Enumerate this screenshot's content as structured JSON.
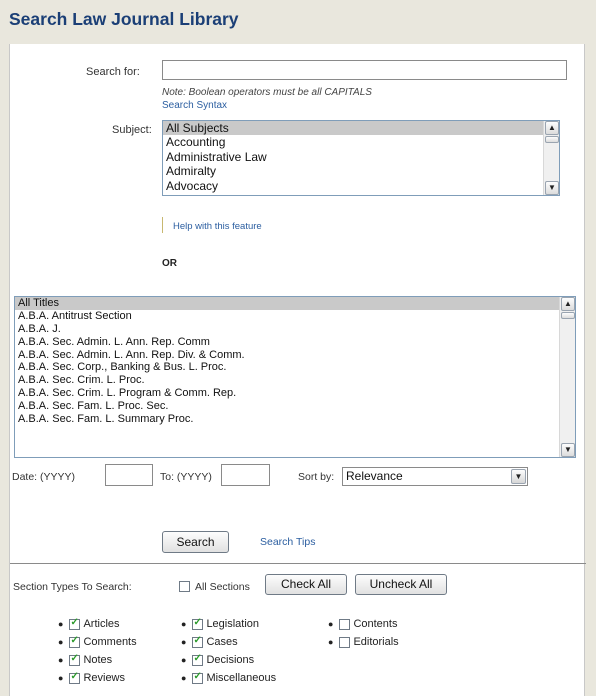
{
  "page": {
    "title": "Search Law Journal Library"
  },
  "search": {
    "label": "Search for:",
    "value": "",
    "note": "Note: Boolean operators must be all CAPITALS",
    "syntax_link": "Search Syntax"
  },
  "subject": {
    "label": "Subject:",
    "options": [
      "All Subjects",
      "Accounting",
      "Administrative Law",
      "Admiralty",
      "Advocacy"
    ],
    "selected": "All Subjects",
    "help_link": "Help with this feature"
  },
  "or_label": "OR",
  "titles": {
    "options": [
      "All Titles",
      "A.B.A. Antitrust Section",
      "A.B.A. J.",
      "A.B.A. Sec. Admin. L. Ann. Rep. Comm",
      "A.B.A. Sec. Admin. L. Ann. Rep. Div. & Comm.",
      "A.B.A. Sec. Corp., Banking & Bus. L. Proc.",
      "A.B.A. Sec. Crim. L. Proc.",
      "A.B.A. Sec. Crim. L. Program & Comm. Rep.",
      "A.B.A. Sec. Fam. L. Proc. Sec.",
      "A.B.A. Sec. Fam. L. Summary Proc."
    ],
    "selected": "All Titles"
  },
  "date": {
    "from_label": "Date: (YYYY)",
    "from_value": "",
    "to_label": "To: (YYYY)",
    "to_value": ""
  },
  "sort": {
    "label": "Sort by:",
    "value": "Relevance"
  },
  "actions": {
    "search_button": "Search",
    "tips_link": "Search Tips"
  },
  "sections": {
    "label": "Section Types To Search:",
    "all_sections_label": "All Sections",
    "all_sections_checked": false,
    "check_all_button": "Check All",
    "uncheck_all_button": "Uncheck All",
    "col1": [
      {
        "label": "Articles",
        "checked": true
      },
      {
        "label": "Comments",
        "checked": true
      },
      {
        "label": "Notes",
        "checked": true
      },
      {
        "label": "Reviews",
        "checked": true
      }
    ],
    "col2": [
      {
        "label": "Legislation",
        "checked": true
      },
      {
        "label": "Cases",
        "checked": true
      },
      {
        "label": "Decisions",
        "checked": true
      },
      {
        "label": "Miscellaneous",
        "checked": true
      }
    ],
    "col3": [
      {
        "label": "Contents",
        "checked": false
      },
      {
        "label": "Editorials",
        "checked": false
      }
    ]
  },
  "icons": {
    "scroll_up": "scroll-up-arrow-icon",
    "scroll_down": "scroll-down-arrow-icon",
    "dropdown": "chevron-down-icon",
    "checkmark": "checkmark-icon"
  },
  "colors": {
    "title": "#1b3f76",
    "link": "#2b5ea0",
    "check": "#2c9a2c",
    "selection": "#c9c9c9"
  }
}
